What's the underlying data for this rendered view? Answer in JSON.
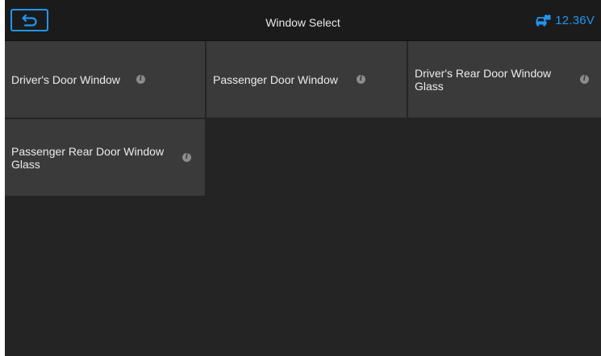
{
  "header": {
    "title": "Window Select",
    "voltage": "12.36V"
  },
  "colors": {
    "accent": "#2196f3",
    "background": "#242424",
    "tile": "#3a3a3b",
    "header": "#1b1b1b"
  },
  "tiles": [
    {
      "label": "Driver's Door Window",
      "icon": "info-icon"
    },
    {
      "label": "Passenger Door Window",
      "icon": "info-icon"
    },
    {
      "label": "Driver's Rear Door Window Glass",
      "icon": "info-icon"
    },
    {
      "label": "Passenger Rear Door Window Glass",
      "icon": "info-icon"
    }
  ]
}
